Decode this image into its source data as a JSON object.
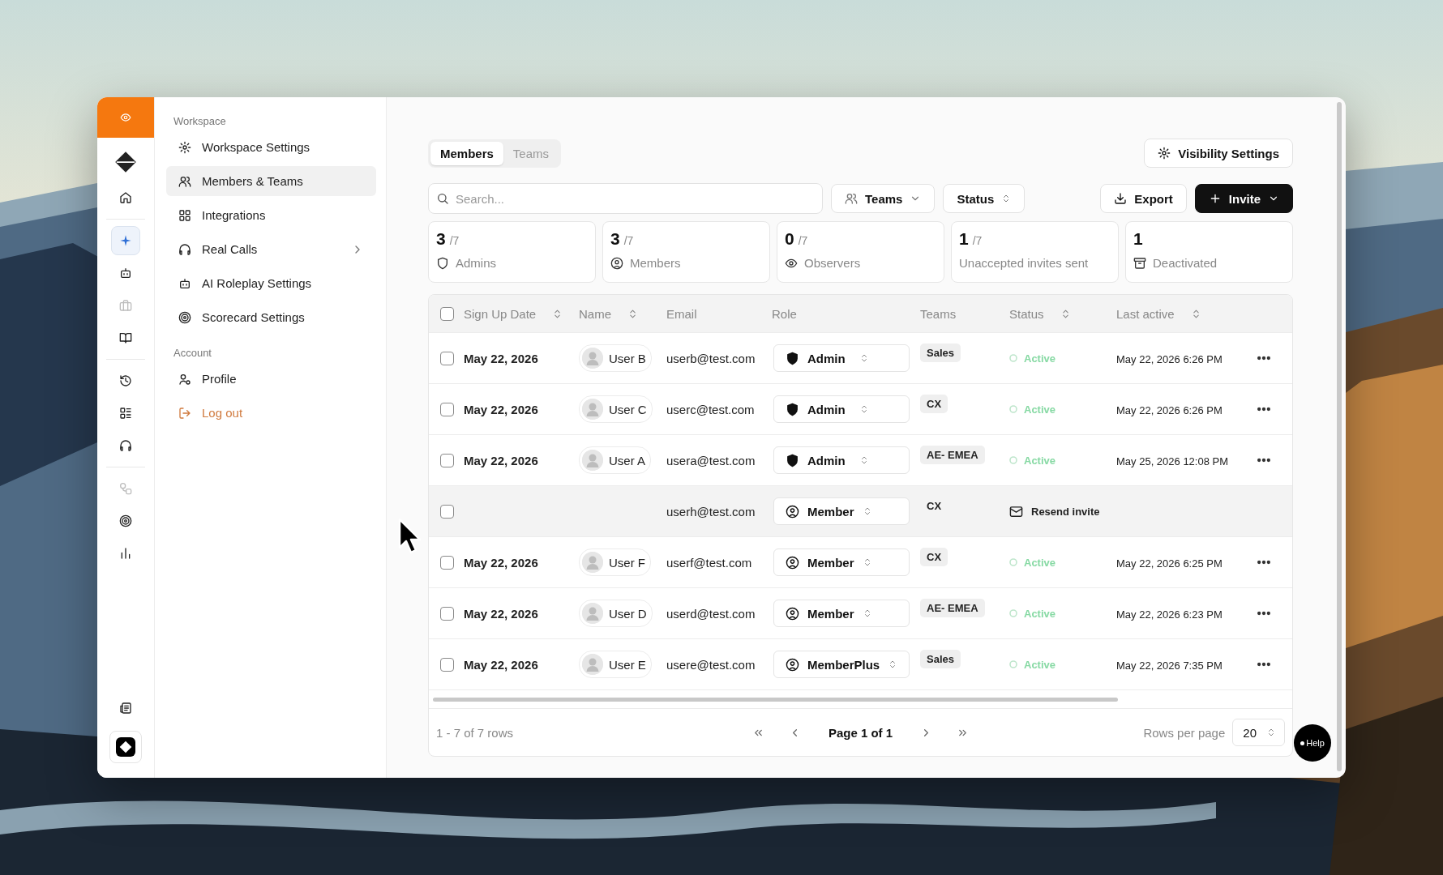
{
  "rail": {
    "groups": [
      {
        "items": [
          {
            "kind": "brand",
            "selected": false,
            "disabled": false
          },
          {
            "kind": "home",
            "selected": false,
            "disabled": false
          }
        ]
      },
      {
        "items": [
          {
            "kind": "sparkle",
            "selected": true,
            "disabled": false
          },
          {
            "kind": "bot",
            "selected": false,
            "disabled": false
          },
          {
            "kind": "briefcase",
            "selected": false,
            "disabled": true
          },
          {
            "kind": "book",
            "selected": false,
            "disabled": false
          }
        ]
      },
      {
        "items": [
          {
            "kind": "history",
            "selected": false,
            "disabled": false
          },
          {
            "kind": "list",
            "selected": false,
            "disabled": false
          },
          {
            "kind": "headset",
            "selected": false,
            "disabled": false
          }
        ]
      },
      {
        "items": [
          {
            "kind": "workflow",
            "selected": false,
            "disabled": true
          },
          {
            "kind": "target",
            "selected": false,
            "disabled": false
          },
          {
            "kind": "chart",
            "selected": false,
            "disabled": false
          }
        ]
      }
    ],
    "bottom": [
      {
        "kind": "news",
        "selected": false
      },
      {
        "kind": "brand-box",
        "selected": false
      }
    ]
  },
  "sidebar": {
    "sections": [
      {
        "title": "Workspace",
        "items": [
          {
            "label": "Workspace Settings",
            "kind": "settings",
            "selected": false,
            "submenu": false
          },
          {
            "label": "Members & Teams",
            "kind": "users",
            "selected": true,
            "submenu": false
          },
          {
            "label": "Integrations",
            "kind": "blocks",
            "selected": false,
            "submenu": false
          },
          {
            "label": "Real Calls",
            "kind": "headset",
            "selected": false,
            "submenu": true
          },
          {
            "label": "AI Roleplay Settings",
            "kind": "bot",
            "selected": false,
            "submenu": false
          },
          {
            "label": "Scorecard Settings",
            "kind": "target",
            "selected": false,
            "submenu": false
          }
        ]
      },
      {
        "title": "Account",
        "items": [
          {
            "label": "Profile",
            "kind": "profile",
            "selected": false,
            "submenu": false
          },
          {
            "label": "Log out",
            "kind": "logout",
            "selected": false,
            "submenu": false
          }
        ]
      }
    ]
  },
  "main": {
    "tabs": [
      {
        "label": "Members",
        "selected": true
      },
      {
        "label": "Teams",
        "selected": false
      }
    ],
    "visibility_button": "Visibility Settings",
    "search": {
      "placeholder": "Search..."
    },
    "filters": [
      {
        "label": "Teams",
        "kind": "teams"
      },
      {
        "label": "Status",
        "kind": "status"
      }
    ],
    "actions": [
      {
        "label": "Export",
        "kind": "export"
      },
      {
        "label": "Invite",
        "kind": "invite"
      }
    ],
    "stats": [
      {
        "value": "3",
        "total": "/7",
        "label": "Admins",
        "kind": "shield"
      },
      {
        "value": "3",
        "total": "/7",
        "label": "Members",
        "kind": "user"
      },
      {
        "value": "0",
        "total": "/7",
        "label": "Observers",
        "kind": "eye"
      },
      {
        "value": "1",
        "total": "/7",
        "label": "Unaccepted invites sent",
        "kind": "plain"
      },
      {
        "value": "1",
        "label": "Deactivated",
        "kind": "archive"
      }
    ]
  },
  "table": {
    "select_all": false,
    "columns": [
      {
        "label": "Sign Up Date",
        "sortable": true
      },
      {
        "label": "Name",
        "sortable": true
      },
      {
        "label": "Email",
        "sortable": false
      },
      {
        "label": "Role",
        "sortable": false
      },
      {
        "label": "Teams",
        "sortable": false
      },
      {
        "label": "Status",
        "sortable": true
      },
      {
        "label": "Last active",
        "sortable": true
      }
    ],
    "rows": [
      {
        "checked": false,
        "hovered": false,
        "sign_up": "May 22, 2026",
        "name": "User B",
        "email": "userb@test.com",
        "role": {
          "label": "Admin",
          "kind": "admin"
        },
        "team": "Sales",
        "status": {
          "kind": "active",
          "label": "Active"
        },
        "last_active": "May 22, 2026 6:26 PM"
      },
      {
        "checked": false,
        "hovered": false,
        "sign_up": "May 22, 2026",
        "name": "User C",
        "email": "userc@test.com",
        "role": {
          "label": "Admin",
          "kind": "admin"
        },
        "team": "CX",
        "status": {
          "kind": "active",
          "label": "Active"
        },
        "last_active": "May 22, 2026 6:26 PM"
      },
      {
        "checked": false,
        "hovered": false,
        "sign_up": "May 22, 2026",
        "name": "User A",
        "email": "usera@test.com",
        "role": {
          "label": "Admin",
          "kind": "admin"
        },
        "team": "AE- EMEA",
        "status": {
          "kind": "active",
          "label": "Active"
        },
        "last_active": "May 25, 2026 12:08 PM"
      },
      {
        "checked": false,
        "hovered": true,
        "email": "userh@test.com",
        "role": {
          "label": "Member",
          "kind": "member"
        },
        "team": "CX",
        "status": {
          "kind": "invite",
          "label": "Resend invite"
        }
      },
      {
        "checked": false,
        "hovered": false,
        "sign_up": "May 22, 2026",
        "name": "User F",
        "email": "userf@test.com",
        "role": {
          "label": "Member",
          "kind": "member"
        },
        "team": "CX",
        "status": {
          "kind": "active",
          "label": "Active"
        },
        "last_active": "May 22, 2026 6:25 PM"
      },
      {
        "checked": false,
        "hovered": false,
        "sign_up": "May 22, 2026",
        "name": "User D",
        "email": "userd@test.com",
        "role": {
          "label": "Member",
          "kind": "member"
        },
        "team": "AE- EMEA",
        "status": {
          "kind": "active",
          "label": "Active"
        },
        "last_active": "May 22, 2026 6:23 PM"
      },
      {
        "checked": false,
        "hovered": false,
        "sign_up": "May 22, 2026",
        "name": "User E",
        "email": "usere@test.com",
        "role": {
          "label": "MemberPlus",
          "kind": "member"
        },
        "team": "Sales",
        "status": {
          "kind": "active",
          "label": "Active"
        },
        "last_active": "May 22, 2026 7:35 PM"
      }
    ],
    "range": "1 - 7 of 7 rows",
    "page": "Page 1 of 1",
    "rows_per_page_label": "Rows per page",
    "rows_per_page": "20"
  },
  "help": {
    "label": "Help"
  }
}
